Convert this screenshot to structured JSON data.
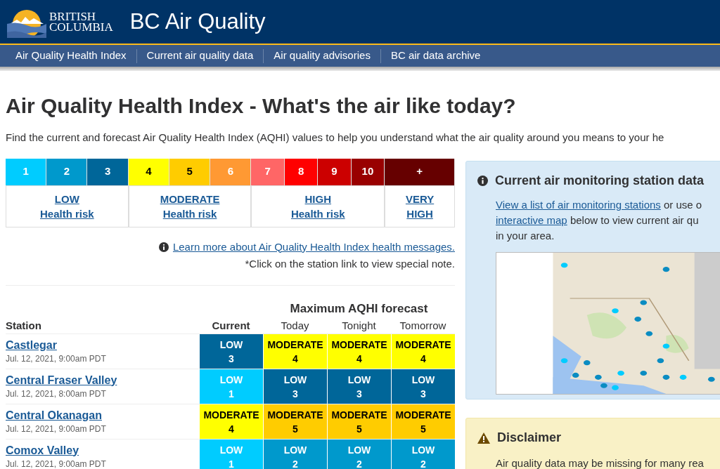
{
  "header": {
    "logo_lines": [
      "BRITISH",
      "COLUMBIA"
    ],
    "title": "BC Air Quality"
  },
  "nav": [
    {
      "label": "Air Quality Health Index"
    },
    {
      "label": "Current air quality data"
    },
    {
      "label": "Air quality advisories"
    },
    {
      "label": "BC air data archive"
    }
  ],
  "page_title": "Air Quality Health Index - What's the air like today?",
  "intro": "Find the current and forecast Air Quality Health Index (AQHI) values to help you understand what the air quality around you means to your he",
  "scale": [
    {
      "lines": [
        "LOW",
        "Health risk"
      ],
      "levels": [
        {
          "label": "1",
          "color": "#00ccff"
        },
        {
          "label": "2",
          "color": "#0099cc"
        },
        {
          "label": "3",
          "color": "#006699"
        }
      ]
    },
    {
      "lines": [
        "MODERATE",
        "Health risk"
      ],
      "levels": [
        {
          "label": "4",
          "color": "#ffff00"
        },
        {
          "label": "5",
          "color": "#ffcc00"
        },
        {
          "label": "6",
          "color": "#ff9933"
        }
      ]
    },
    {
      "lines": [
        "HIGH",
        "Health risk"
      ],
      "levels": [
        {
          "label": "7",
          "color": "#ff6666"
        },
        {
          "label": "8",
          "color": "#ff0000"
        },
        {
          "label": "9",
          "color": "#cc0000"
        },
        {
          "label": "10",
          "color": "#990000"
        }
      ]
    },
    {
      "lines": [
        "VERY",
        "HIGH"
      ],
      "levels": [
        {
          "label": "+",
          "color": "#660000"
        }
      ]
    }
  ],
  "learn_more_link": "Learn more about Air Quality Health Index health messages.",
  "station_note": "*Click on the station link to view special note.",
  "table": {
    "group_heading": "Maximum AQHI forecast",
    "station_heading": "Station",
    "columns": [
      "Current",
      "Today",
      "Tonight",
      "Tomorrow"
    ],
    "rows": [
      {
        "station": "Castlegar",
        "time": "Jul. 12, 2021, 9:00am PDT",
        "cells": [
          {
            "risk": "LOW",
            "value": "3",
            "color": "#006699"
          },
          {
            "risk": "MODERATE",
            "value": "4",
            "color": "#ffff00"
          },
          {
            "risk": "MODERATE",
            "value": "4",
            "color": "#ffff00"
          },
          {
            "risk": "MODERATE",
            "value": "4",
            "color": "#ffff00"
          }
        ]
      },
      {
        "station": "Central Fraser Valley",
        "time": "Jul. 12, 2021, 8:00am PDT",
        "cells": [
          {
            "risk": "LOW",
            "value": "1",
            "color": "#00ccff"
          },
          {
            "risk": "LOW",
            "value": "3",
            "color": "#006699"
          },
          {
            "risk": "LOW",
            "value": "3",
            "color": "#006699"
          },
          {
            "risk": "LOW",
            "value": "3",
            "color": "#006699"
          }
        ]
      },
      {
        "station": "Central Okanagan",
        "time": "Jul. 12, 2021, 9:00am PDT",
        "cells": [
          {
            "risk": "MODERATE",
            "value": "4",
            "color": "#ffff00"
          },
          {
            "risk": "MODERATE",
            "value": "5",
            "color": "#ffcc00"
          },
          {
            "risk": "MODERATE",
            "value": "5",
            "color": "#ffcc00"
          },
          {
            "risk": "MODERATE",
            "value": "5",
            "color": "#ffcc00"
          }
        ]
      },
      {
        "station": "Comox Valley",
        "time": "Jul. 12, 2021, 9:00am PDT",
        "cells": [
          {
            "risk": "LOW",
            "value": "1",
            "color": "#00ccff"
          },
          {
            "risk": "LOW",
            "value": "2",
            "color": "#0099cc"
          },
          {
            "risk": "LOW",
            "value": "2",
            "color": "#0099cc"
          },
          {
            "risk": "LOW",
            "value": "2",
            "color": "#0099cc"
          }
        ]
      }
    ]
  },
  "monitoring_panel": {
    "title": "Current air monitoring station data",
    "lines": [
      [
        {
          "kind": "link",
          "text": "View a list of air monitoring stations"
        },
        {
          "kind": "text",
          "text": " or use o"
        }
      ],
      [
        {
          "kind": "link",
          "text": "interactive map"
        },
        {
          "kind": "text",
          "text": " below to view current air qu"
        }
      ],
      [
        {
          "kind": "text",
          "text": "in your area."
        }
      ]
    ],
    "map": {
      "kind": "picture"
    }
  },
  "disclaimer": {
    "title": "Disclaimer",
    "text": "Air quality data may be missing for many rea"
  }
}
